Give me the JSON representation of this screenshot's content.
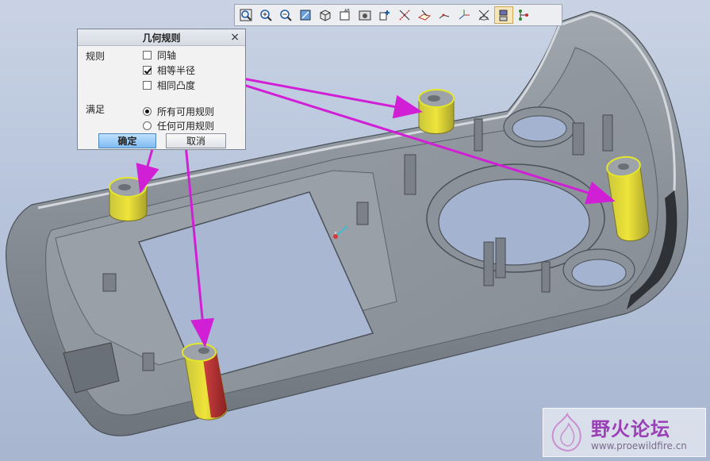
{
  "toolbar": {
    "icons": [
      "zoom-fit-icon",
      "zoom-in-icon",
      "zoom-out-icon",
      "repaint-icon",
      "orient-icon",
      "saved-views-icon",
      "display-style-icon",
      "spin-center-icon",
      "datum-axes-icon",
      "datum-planes-icon",
      "datum-points-icon",
      "csys-icon",
      "annotations-icon",
      "model-tree-icon",
      "network-icon"
    ],
    "active_icon": "annotations-icon"
  },
  "dialog": {
    "title": "几何规则",
    "close": "×",
    "rules_label": "规则",
    "options": [
      {
        "label": "同轴",
        "checked": false
      },
      {
        "label": "相等半径",
        "checked": true
      },
      {
        "label": "相同凸度",
        "checked": false
      }
    ],
    "satisfy_label": "满足",
    "radios": [
      {
        "label": "所有可用规则",
        "selected": true
      },
      {
        "label": "任何可用规则",
        "selected": false
      }
    ],
    "ok_label": "确定",
    "cancel_label": "取消"
  },
  "colors": {
    "arrow": "#d11fd6",
    "highlight": "#e4e62a",
    "selected": "#c02c2c",
    "model": "#8e949c"
  },
  "watermark": {
    "title": "野火论坛",
    "url": "www.proewildfire.cn"
  }
}
